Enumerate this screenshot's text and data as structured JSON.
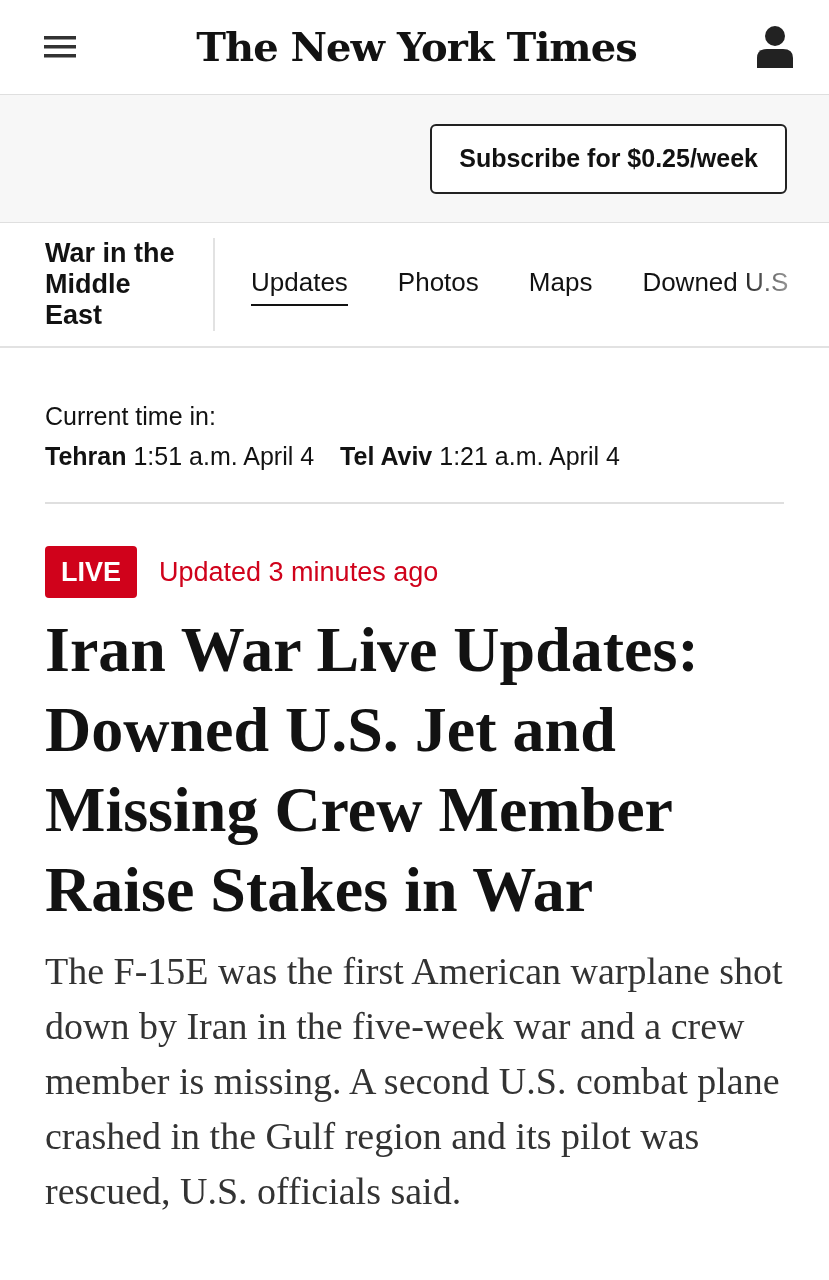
{
  "header": {
    "logo": "The New York Times"
  },
  "subscribe_button": "Subscribe for $0.25/week",
  "section": {
    "title": "War in the Middle East",
    "tabs": [
      {
        "label": "Updates",
        "selected": true
      },
      {
        "label": "Photos",
        "selected": false
      },
      {
        "label": "Maps",
        "selected": false
      },
      {
        "label": "Downed U.S",
        "selected": false
      }
    ]
  },
  "clock": {
    "label": "Current time in:",
    "cities": [
      {
        "city": "Tehran",
        "time": "1:51 a.m. April 4"
      },
      {
        "city": "Tel Aviv",
        "time": "1:21 a.m. April 4"
      }
    ]
  },
  "live_badge": "LIVE",
  "updated": "Updated 3 minutes ago",
  "headline": "Iran War Live Updates: Downed U.S. Jet and Missing Crew Member Raise Stakes in War",
  "summary": "The F-15E was the first American warplane shot down by Iran in the five-week war and a crew member is missing. A second U.S. combat plane crashed in the Gulf region and its pilot was rescued, U.S. officials said."
}
